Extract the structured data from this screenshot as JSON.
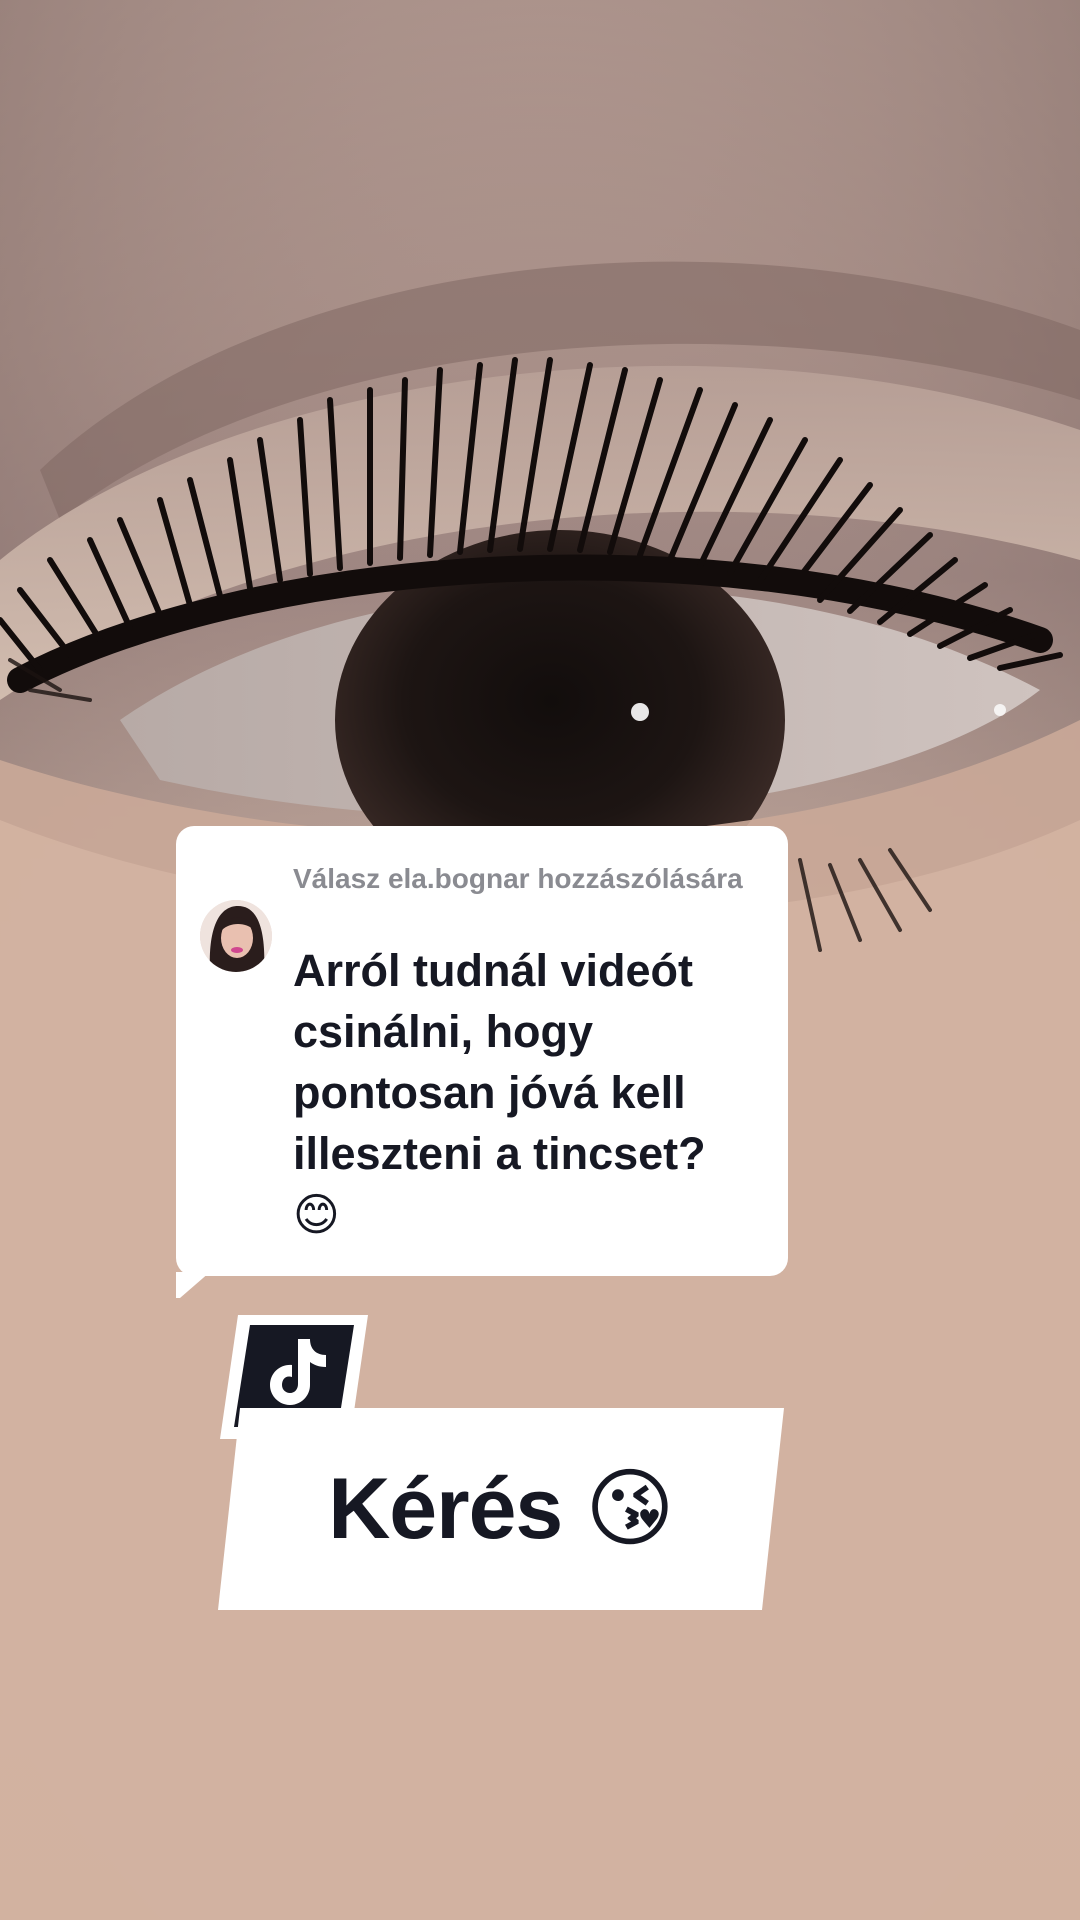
{
  "reply": {
    "header": "Válasz ela.bognar hozzászólására",
    "text": "Arról tudnál videót csinálni, hogy pontosan jóvá kell illeszteni a tincset?",
    "emoji": "😊"
  },
  "caption": {
    "text": "Kérés",
    "emoji": "😘"
  },
  "icons": {
    "logo": "tiktok-logo-icon",
    "avatar": "commenter-avatar"
  },
  "colors": {
    "text_dark": "#161823",
    "text_muted": "#8a8b91",
    "card": "#ffffff",
    "logo_bg": "#161823"
  }
}
